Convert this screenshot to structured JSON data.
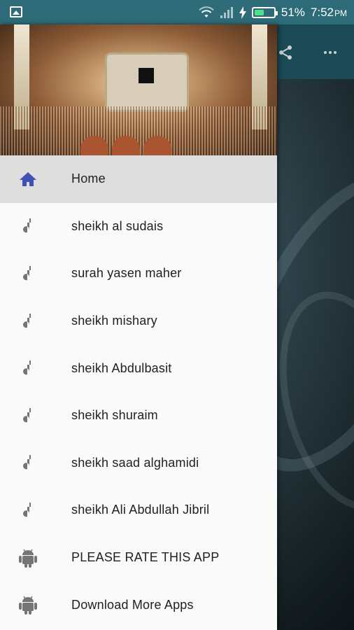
{
  "status_bar": {
    "battery_percent": "51%",
    "time": "7:52",
    "ampm": "PM",
    "battery_level": 0.51
  },
  "toolbar": {
    "share_icon": "share-icon",
    "overflow_icon": "more-icon"
  },
  "drawer": {
    "items": [
      {
        "label": "Home",
        "icon": "home-icon",
        "active": true
      },
      {
        "label": "sheikh al sudais",
        "icon": "music-note-icon"
      },
      {
        "label": "surah yasen maher",
        "icon": "music-note-icon"
      },
      {
        "label": "sheikh mishary",
        "icon": "music-note-icon"
      },
      {
        "label": "sheikh Abdulbasit",
        "icon": "music-note-icon"
      },
      {
        "label": "sheikh shuraim",
        "icon": "music-note-icon"
      },
      {
        "label": "sheikh saad alghamidi",
        "icon": "music-note-icon"
      },
      {
        "label": "sheikh Ali Abdullah Jibril",
        "icon": "music-note-icon"
      },
      {
        "label": "PLEASE RATE THIS APP",
        "icon": "android-icon"
      },
      {
        "label": "Download More Apps",
        "icon": "android-icon"
      }
    ]
  },
  "colors": {
    "accent": "#3f51b5",
    "icon_gray": "#757575",
    "status_bar": "#2d6b79",
    "toolbar": "#1c4a56",
    "active_row": "#dedede"
  }
}
